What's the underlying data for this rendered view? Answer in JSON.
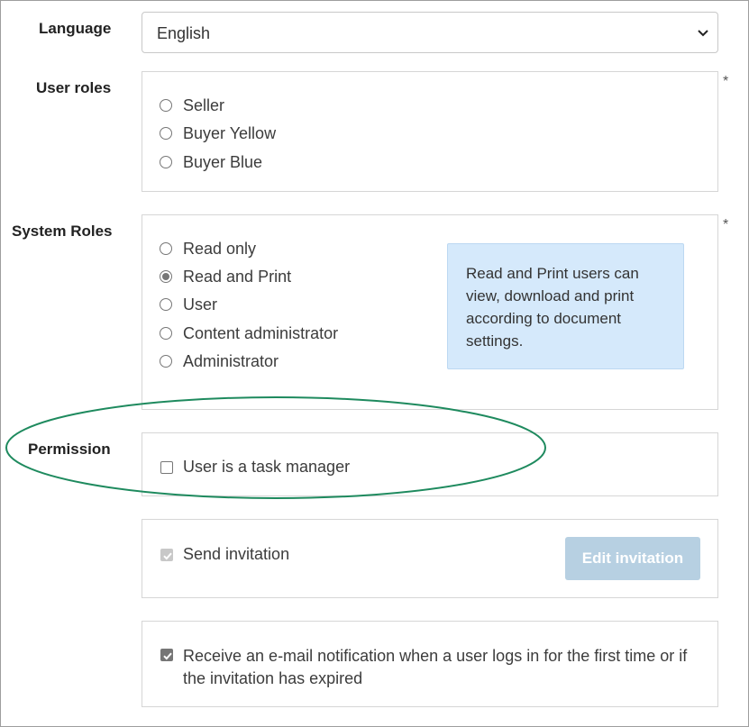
{
  "language": {
    "label": "Language",
    "selected": "English",
    "dropdown_icon": "chevron-down-icon"
  },
  "user_roles": {
    "label": "User roles",
    "required_mark": "*",
    "options": [
      {
        "label": "Seller",
        "checked": false
      },
      {
        "label": "Buyer Yellow",
        "checked": false
      },
      {
        "label": "Buyer Blue",
        "checked": false
      }
    ]
  },
  "system_roles": {
    "label": "System Roles",
    "required_mark": "*",
    "options": [
      {
        "label": "Read only",
        "checked": false
      },
      {
        "label": "Read and Print",
        "checked": true
      },
      {
        "label": "User",
        "checked": false
      },
      {
        "label": "Content administrator",
        "checked": false
      },
      {
        "label": "Administrator",
        "checked": false
      }
    ],
    "info_text": "Read and Print users can view, download and print according to document settings."
  },
  "permission": {
    "label": "Permission",
    "task_manager_label": "User is a task manager",
    "task_manager_checked": false
  },
  "invitation": {
    "send_label": "Send invitation",
    "send_checked": true,
    "send_disabled": true,
    "edit_button_label": "Edit invitation"
  },
  "notification": {
    "label": "Receive an e-mail notification when a user logs in for the first time or if the invitation has expired",
    "checked": true
  },
  "colors": {
    "highlight_ellipse": "#1e8a5e",
    "info_background": "#d5e9fb",
    "button_disabled": "#b7d0e2"
  }
}
